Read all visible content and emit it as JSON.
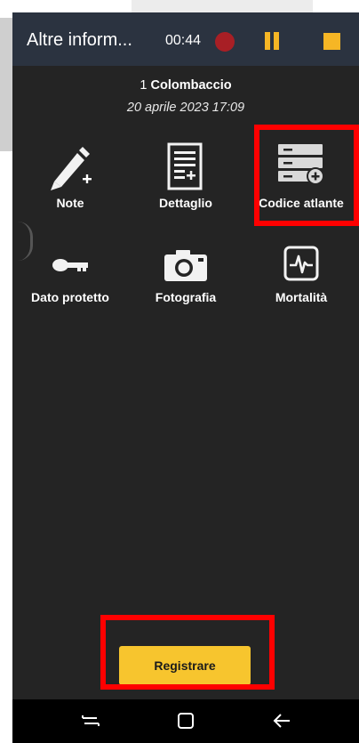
{
  "header": {
    "title": "Altre inform...",
    "timer": "00:44"
  },
  "observation": {
    "count": "1",
    "species": "Colombaccio",
    "datetime": "20 aprile 2023 17:09"
  },
  "tiles": [
    {
      "label": "Note",
      "icon": "pencil-plus-icon"
    },
    {
      "label": "Dettaglio",
      "icon": "document-plus-icon"
    },
    {
      "label": "Codice atlante",
      "icon": "list-plus-icon"
    },
    {
      "label": "Dato protetto",
      "icon": "key-icon"
    },
    {
      "label": "Fotografia",
      "icon": "camera-icon"
    },
    {
      "label": "Mortalità",
      "icon": "heart-monitor-icon"
    }
  ],
  "actions": {
    "register_label": "Registrare"
  },
  "colors": {
    "accent": "#f7c52e",
    "header_bg": "#2b3340",
    "screen_bg": "#242424",
    "highlight": "#ff0000",
    "record": "#a81f25"
  },
  "navbar": {
    "icons": [
      "recent-apps-icon",
      "home-icon",
      "back-icon"
    ]
  }
}
